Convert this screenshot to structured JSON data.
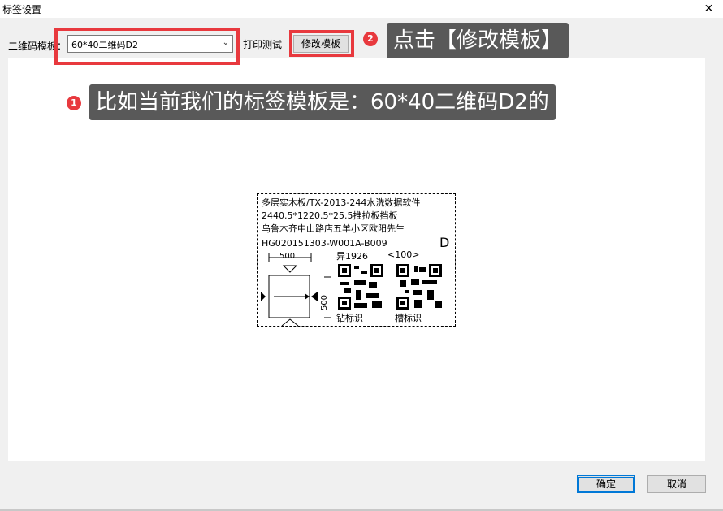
{
  "window": {
    "title": "标签设置",
    "close_glyph": "✕"
  },
  "toolbar": {
    "template_label": "二维码模板：",
    "template_value": "60*40二维码D2",
    "print_test": "打印测试",
    "edit_template": "修改模板"
  },
  "annotations": [
    {
      "number": "1",
      "text": "比如当前我们的标签模板是：60*40二维码D2的"
    },
    {
      "number": "2",
      "text": "点击【修改模板】"
    }
  ],
  "label_preview": {
    "line1": "多层实木板/TX-2013-244水洗数据软件",
    "line2": "2440.5*1220.5*25.5推拉板挡板",
    "line3": "乌鲁木齐中山路店五羊小区欧阳先生",
    "code": "HG020151303-W001A-B009",
    "letter": "D",
    "width_dim": "500",
    "height_dim": "500",
    "id_text": "异1926",
    "qty_text": "<100>",
    "drill_label": "钻标识",
    "groove_label": "槽标识"
  },
  "footer": {
    "ok": "确定",
    "cancel": "取消"
  }
}
